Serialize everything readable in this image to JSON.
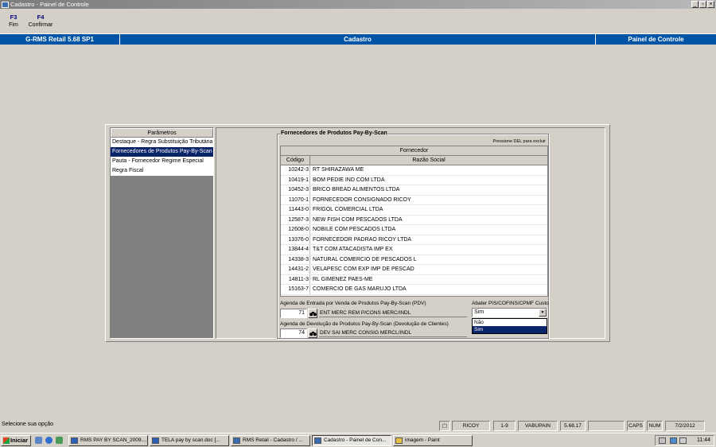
{
  "window": {
    "title": "Cadastro - Painel de Controle"
  },
  "fkeys": [
    {
      "key": "F3",
      "label": "Fim"
    },
    {
      "key": "F4",
      "label": "Confirmar"
    }
  ],
  "header": {
    "product": "G-RMS Retail 5.68 SP1",
    "module": "Cadastro",
    "screen": "Painel de Controle"
  },
  "parameters": {
    "title": "Parâmetros",
    "items": [
      "Destaque - Regra Substituição Tributária",
      "Fornecedores de Produtos Pay-By-Scan",
      "Pauta - Fornecedor Regime Especial",
      "Regra Fiscal"
    ],
    "selected_index": 1
  },
  "suppliers": {
    "group_title": "Fornecedores de Produtos Pay-By-Scan",
    "del_note": "Pressione DEL para excluir",
    "header_top": "Fornecedor",
    "col_code": "Código",
    "col_name": "Razão Social",
    "rows": [
      {
        "code": "10242-3",
        "name": "RT SHIRAZAWA ME"
      },
      {
        "code": "10419-1",
        "name": "BOM PEDIE IND COM LTDA"
      },
      {
        "code": "10452-3",
        "name": "BRICO BREAD ALIMENTOS LTDA"
      },
      {
        "code": "11070-1",
        "name": "FORNECEDOR CONSIGNADO RICOY"
      },
      {
        "code": "11443-0",
        "name": "FRIGOL COMERCIAL LTDA"
      },
      {
        "code": "12587-3",
        "name": "NEW FISH COM PESCADOS LTDA"
      },
      {
        "code": "12608-0",
        "name": "NOBILE COM PESCADOS LTDA"
      },
      {
        "code": "13376-0",
        "name": "FORNECEDOR PADRAO RICOY LTDA"
      },
      {
        "code": "13844-4",
        "name": "T&T COM ATACADISTA IMP EX"
      },
      {
        "code": "14338-3",
        "name": "NATURAL COMERCIO DE PESCADOS L"
      },
      {
        "code": "14431-2",
        "name": "VELAPESC COM EXP IMP DE PESCAD"
      },
      {
        "code": "14811-3",
        "name": "RL GIMENEZ PAES-ME"
      },
      {
        "code": "15163-7",
        "name": "COMERCIO DE GAS MARUJO LTDA"
      }
    ]
  },
  "agenda_entrada": {
    "label": "Agenda de Entrada por Venda de Produtos Pay-By-Scan (PDV)",
    "code": "71",
    "desc": "ENT MERC REM P/CONS MERC/INDL"
  },
  "agenda_devolucao": {
    "label": "Agenda de Devolução de Produtos Pay-By-Scan (Devolução de Clientes)",
    "code": "74",
    "desc": "DEV SAI MERC CONSIG MERCL/INDL"
  },
  "abater": {
    "label": "Abater PIS/COFINS/CPMF Custo",
    "value": "Sim",
    "options": [
      "Não",
      "Sim"
    ],
    "selected_index": 1
  },
  "status": {
    "message": "Selecione sua opção",
    "store": "RICOY",
    "range": "1-9",
    "user": "VABUPAIN",
    "version": "5.68.17",
    "caps": "CAPS",
    "num": "NUM",
    "date": "7/2/2012"
  },
  "taskbar": {
    "start": "Iniciar",
    "tasks": [
      "RMS PAY BY SCAN_2009....",
      "TELA pay by scan.doc [...",
      "RMS Retail - Cadastro / ...",
      "Cadastro - Painel de Con...",
      "imagem - Paint"
    ],
    "active_index": 3,
    "clock": "11:44"
  }
}
